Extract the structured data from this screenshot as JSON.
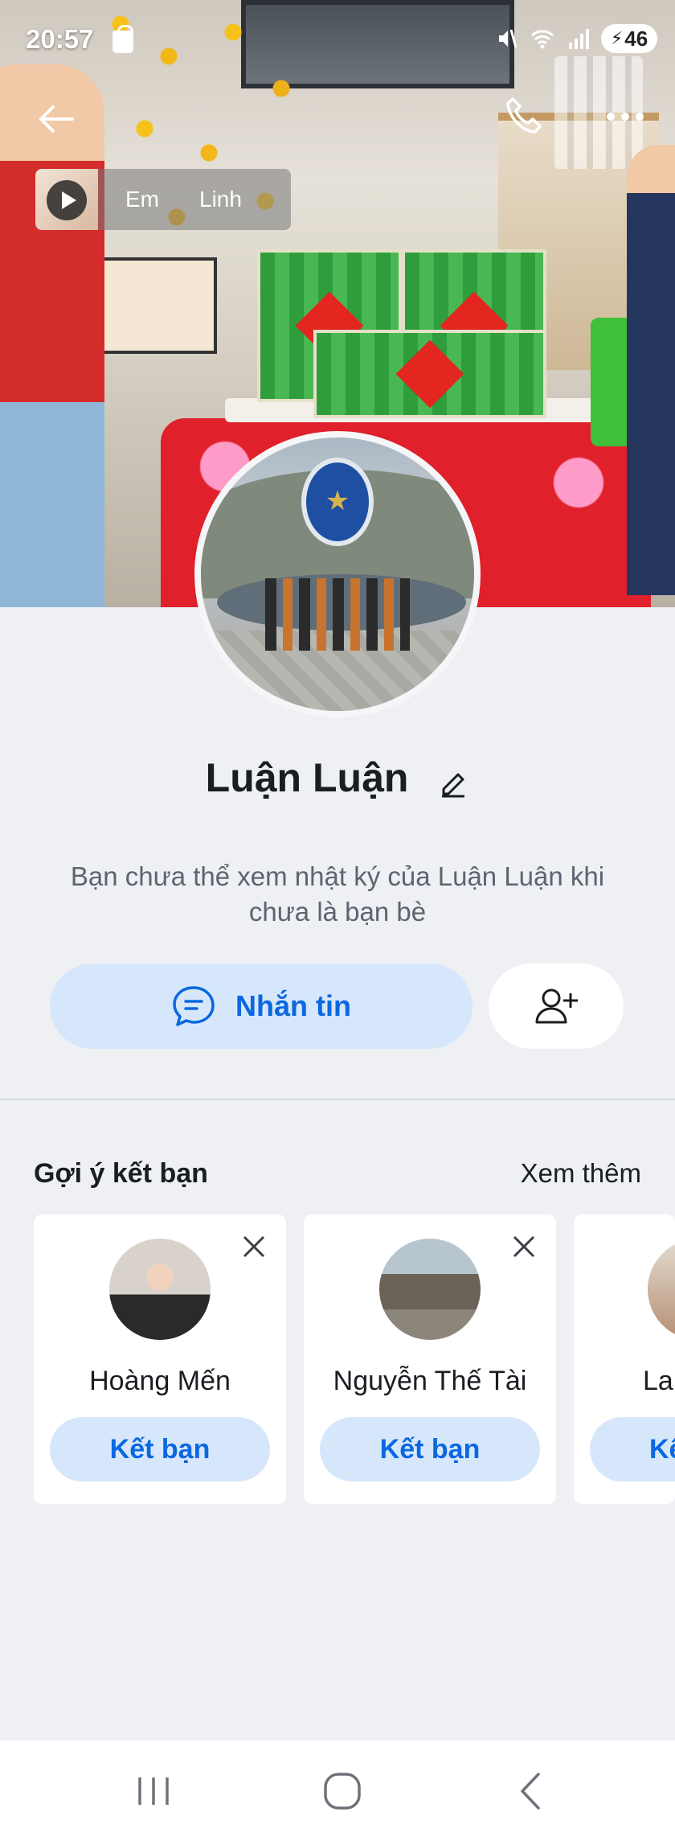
{
  "status_bar": {
    "time": "20:57",
    "battery": "46"
  },
  "story": {
    "names": [
      "Em",
      "Linh"
    ]
  },
  "profile": {
    "name": "Luận Luận",
    "privacy_note": "Bạn chưa thể xem nhật ký của Luận Luận khi chưa là bạn bè",
    "message_label": "Nhắn tin"
  },
  "suggestions": {
    "title": "Gợi ý kết bạn",
    "see_more": "Xem thêm",
    "cards": [
      {
        "name": "Hoàng Mến",
        "button": "Kết bạn"
      },
      {
        "name": "Nguyễn Thế Tài",
        "button": "Kết bạn"
      },
      {
        "name": "La",
        "button": "Kế"
      }
    ]
  },
  "colors": {
    "accent": "#0a68e0",
    "accent_soft": "#d7e7fb",
    "page_bg": "#eef0f4"
  },
  "icons": [
    "back-arrow-icon",
    "phone-icon",
    "more-icon",
    "play-icon",
    "edit-icon",
    "chat-icon",
    "add-friend-icon",
    "close-icon",
    "nav-recents-icon",
    "nav-home-icon",
    "nav-back-icon"
  ]
}
